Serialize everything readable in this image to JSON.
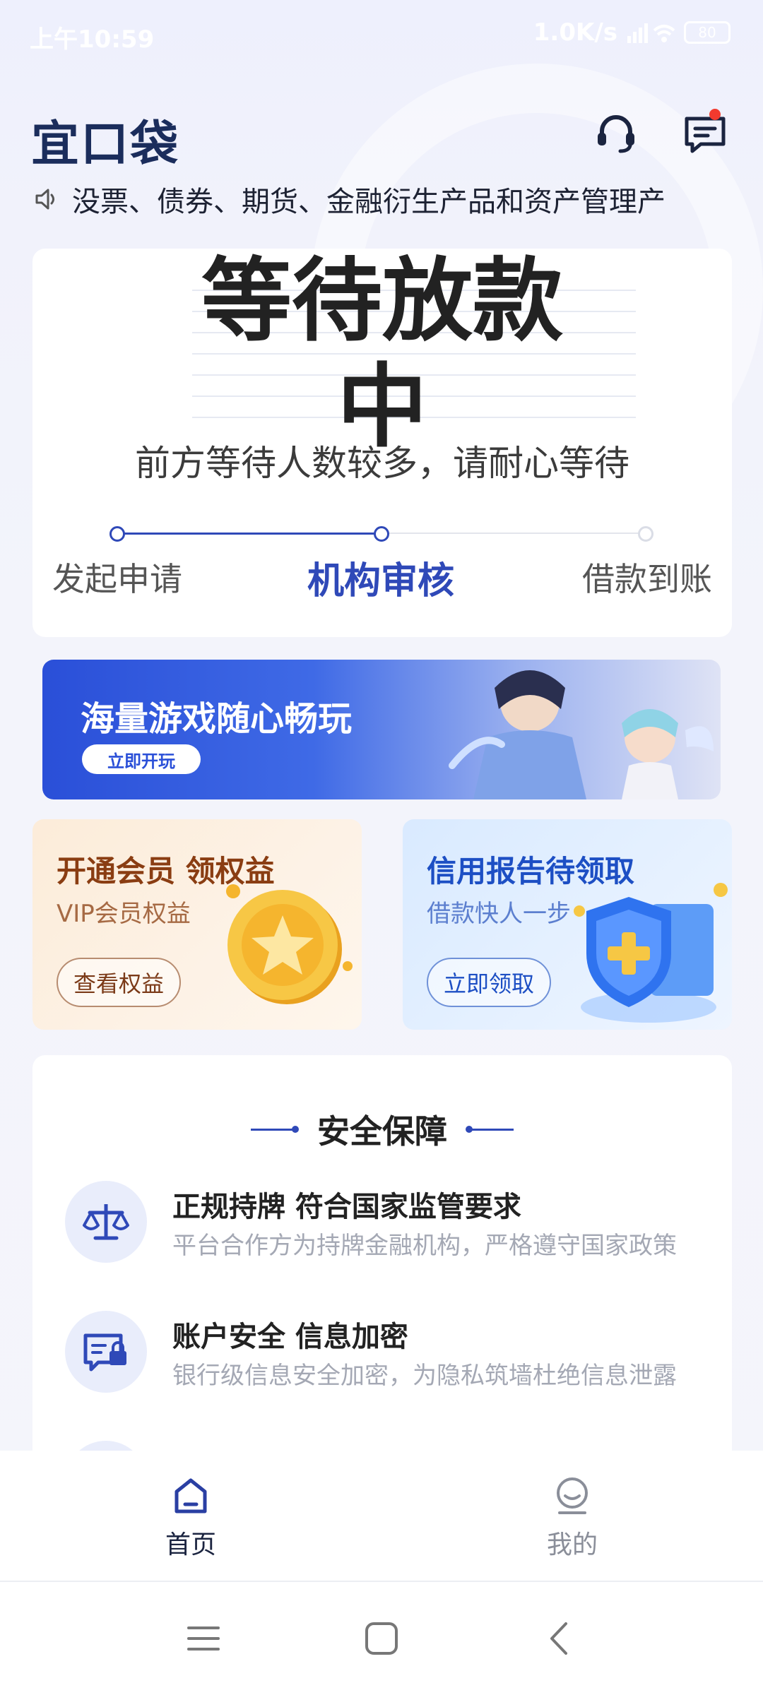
{
  "status_bar": {
    "time": "上午10:59",
    "net_speed": "1.0K/s",
    "battery": "80"
  },
  "header": {
    "logo": "宜口袋",
    "icons": [
      "headset-icon",
      "message-icon"
    ]
  },
  "notice": {
    "text": "没票、债券、期货、金融衍生产品和资产管理产"
  },
  "status_card": {
    "title": "等待放款中",
    "subtitle": "前方等待人数较多，请耐心等待",
    "steps": [
      "发起申请",
      "机构审核",
      "借款到账"
    ],
    "active_step": 1
  },
  "game_banner": {
    "title": "海量游戏随心畅玩",
    "button": "立即开玩"
  },
  "promos": {
    "vip": {
      "title": "开通会员 领权益",
      "subtitle": "VIP会员权益",
      "button": "查看权益"
    },
    "credit": {
      "title": "信用报告待领取",
      "subtitle": "借款快人一步",
      "button": "立即领取"
    }
  },
  "safety": {
    "title": "安全保障",
    "items": [
      {
        "title": "正规持牌 符合国家监管要求",
        "desc": "平台合作方为持牌金融机构，严格遵守国家政策",
        "icon": "scale-icon"
      },
      {
        "title": "账户安全 信息加密",
        "desc": "银行级信息安全加密，为隐私筑墙杜绝信息泄露",
        "icon": "secure-card-icon"
      }
    ]
  },
  "bottom_nav": {
    "items": [
      {
        "label": "首页",
        "icon": "home-icon",
        "active": true
      },
      {
        "label": "我的",
        "icon": "profile-icon",
        "active": false
      }
    ]
  },
  "colors": {
    "brand": "#2f49b8",
    "text_dark": "#1b2d5c",
    "vip_text": "#8a3d12",
    "credit_text": "#1d4fc4"
  }
}
